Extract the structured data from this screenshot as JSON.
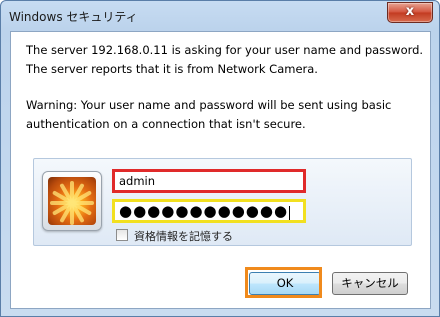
{
  "window": {
    "title": "Windows セキュリティ",
    "close_symbol": "x"
  },
  "message": {
    "line1": "The server 192.168.0.11 is asking for your user name and password. The server reports that it is from Network Camera.",
    "line2": "Warning: Your user name and password will be sent using basic authentication on a connection that isn't secure."
  },
  "credentials": {
    "avatar_icon": "user-avatar-flower",
    "username_value": "admin",
    "password_mask": "●●●●●●●●●●●●",
    "remember_label": "資格情報を記憶する",
    "remember_checked": false
  },
  "buttons": {
    "ok_label": "OK",
    "cancel_label": "キャンセル"
  },
  "colors": {
    "username_highlight": "#e02a2a",
    "password_highlight": "#f2e020",
    "ok_highlight": "#f08a1c"
  }
}
